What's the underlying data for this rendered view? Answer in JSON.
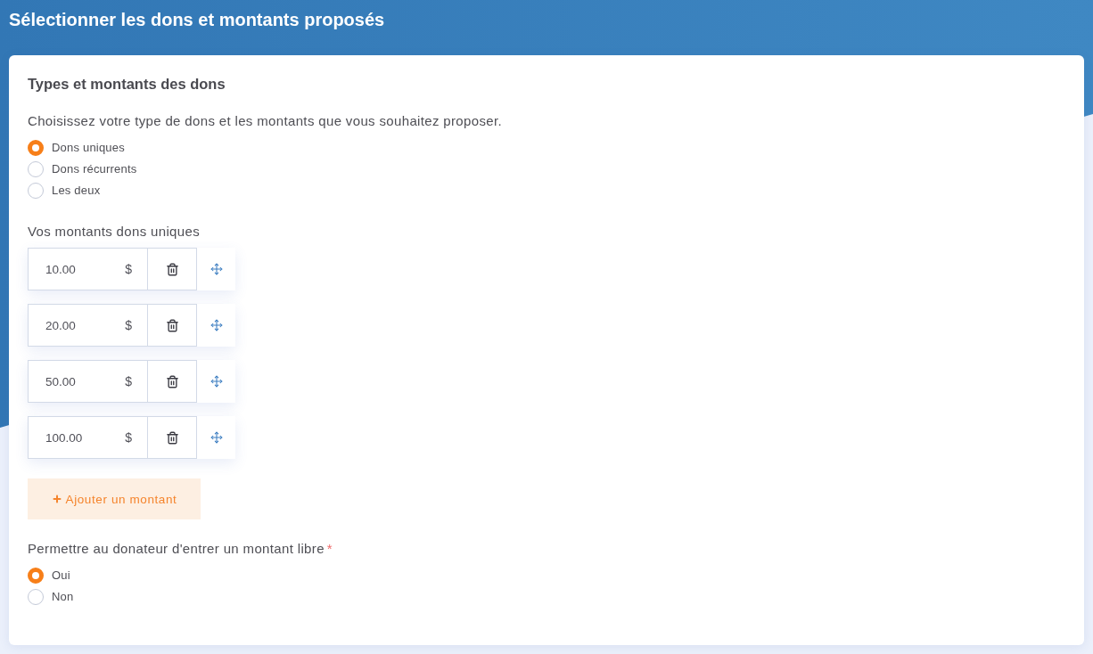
{
  "header": {
    "title": "Sélectionner les dons et montants proposés"
  },
  "card": {
    "title": "Types et montants des dons",
    "donation_type": {
      "prompt": "Choisissez votre type de dons et les montants que vous souhaitez proposer.",
      "options": [
        {
          "label": "Dons uniques",
          "selected": true
        },
        {
          "label": "Dons récurrents",
          "selected": false
        },
        {
          "label": "Les deux",
          "selected": false
        }
      ]
    },
    "amounts": {
      "label": "Vos montants dons uniques",
      "items": [
        {
          "value": "10.00",
          "currency": "$"
        },
        {
          "value": "20.00",
          "currency": "$"
        },
        {
          "value": "50.00",
          "currency": "$"
        },
        {
          "value": "100.00",
          "currency": "$"
        }
      ],
      "add_button": {
        "label": "Ajouter un montant"
      }
    },
    "free_amount": {
      "label": "Permettre au donateur d'entrer un montant libre",
      "required_mark": "*",
      "options": [
        {
          "label": "Oui",
          "selected": true
        },
        {
          "label": "Non",
          "selected": false
        }
      ]
    }
  }
}
